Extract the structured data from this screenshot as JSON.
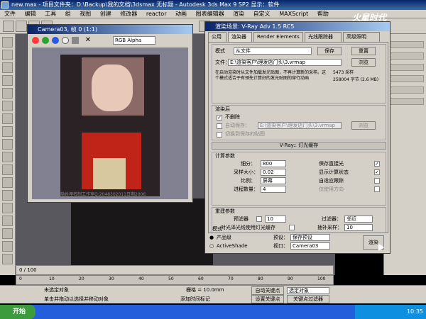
{
  "app": {
    "title": "项目文件夹：D:\\Backup\\我的文档\\3dsmax   无标题 - Autodesk 3ds Max 9 SP2   显示：软件",
    "filename": "new.max",
    "menu": [
      "文件",
      "编辑",
      "工具",
      "组",
      "视图",
      "创建",
      "修改器",
      "reactor",
      "动画",
      "图表编辑器",
      "渲染",
      "自定义",
      "MAXScript",
      "帮助"
    ]
  },
  "camera_window": {
    "title": "Camera03, 帧 0 (1:1)",
    "channel": "RGB Alpha",
    "caption": "隐姓埋名制工作室Q:2048302011日期2006"
  },
  "render_dialog": {
    "title": "渲染场景: V-Ray Adv 1.5 RC5",
    "tabs": [
      "公用",
      "渲染器",
      "Render Elements",
      "光线跟踪器",
      "高级照明"
    ],
    "mode_label": "模式",
    "mode_value": "从文件",
    "save_label": "保存",
    "reset_label": "重置",
    "file_label": "文件：",
    "file_value": "E:\\渲染客户\\理发店门头\\3.vrmap",
    "browse_label": "浏览",
    "description": "在启动渲染时从文件加载发光贴图，不再计算新的采样。这个模式适合于有预先计算好的发光贴图的穿行动画",
    "stats_a": "5473 采样",
    "stats_b": "258004 字节 (2.6 MB)",
    "after_render_header": "渲染后",
    "no_delete": "不删除",
    "auto_save": "自动保存：",
    "auto_save_path": "E:\\渲染客户\\理发店门头\\3.vrmap",
    "browse2": "浏览",
    "switch_saved": "切换到保存的贴图",
    "section_lightcache": "V-Ray:: 灯光缓存",
    "calc_params": "计算参数",
    "subdivs_label": "细分：",
    "subdivs_value": "800",
    "sample_size_label": "采样大小：",
    "sample_size_value": "0.02",
    "scale_label": "比例：",
    "scale_value": "屏幕",
    "passes_label": "进程数量：",
    "passes_value": "4",
    "store_direct": "保存直接光",
    "show_calc": "显示计算状态",
    "adaptive_track": "自适应跟踪",
    "use_dirs": "仅使用方向",
    "rebuild_params": "重建参数",
    "prefilter": "预滤器",
    "prefilter_value": "10",
    "filter_label": "过滤器：",
    "filter_value": "邻近",
    "use_lightcache": "对光泽光线使用灯光缓存",
    "interp_label": "插补采样：",
    "interp_value": "10",
    "mode_section": "模式",
    "product": "产品级",
    "activeshade": "ActiveShade",
    "preset_label": "预设：",
    "preset_value": "保存预设",
    "viewport_label": "视口：",
    "viewport_value": "Camera03",
    "render_button": "渲染"
  },
  "timeline": {
    "frame_label": "0 / 100"
  },
  "ruler_ticks": [
    "0",
    "10",
    "20",
    "30",
    "40",
    "50",
    "60",
    "70",
    "80",
    "90",
    "100"
  ],
  "status": {
    "selected": "未选定对象",
    "prompt": "单击并拖动以选择并移动对象",
    "grid": "栅格 = 10.0mm",
    "auto_key": "自动关键点",
    "set_key": "设置关键点",
    "selection_sets": "选定对象",
    "key_filters": "关键点过滤器",
    "add_time_tag": "添加时间标记"
  },
  "taskbar": {
    "start": "开始",
    "clock": "10:35"
  },
  "watermark": "火星时代"
}
